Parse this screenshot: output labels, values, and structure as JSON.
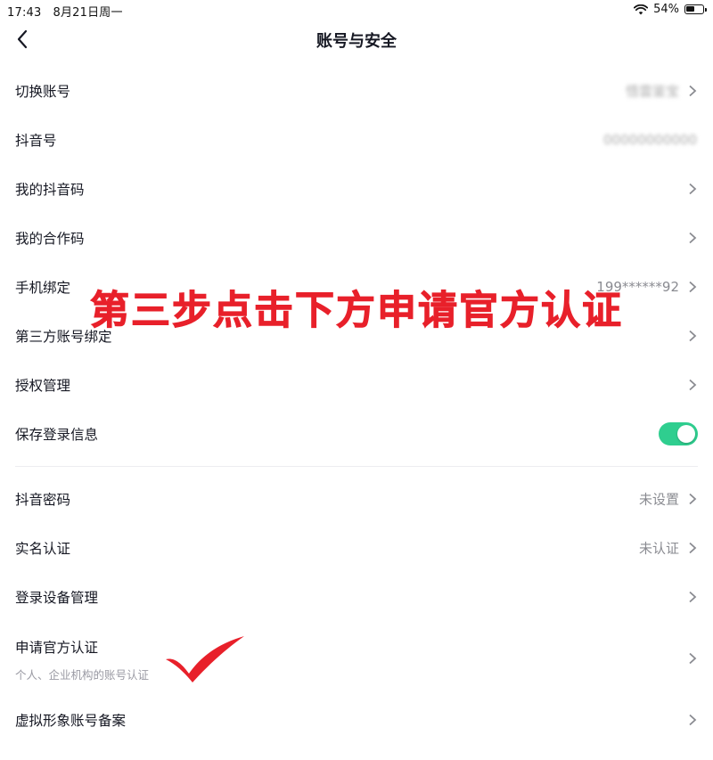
{
  "status_bar": {
    "time": "17:43",
    "date": "8月21日周一",
    "battery": "54%",
    "battery_level": 0.54
  },
  "nav": {
    "title": "账号与安全",
    "back_icon": "chevron-left-icon"
  },
  "rows": [
    {
      "label": "切换账号",
      "value": "悟雲鉴宝",
      "value_blurred": true
    },
    {
      "label": "抖音号",
      "value": "00000000000",
      "value_blurred": true
    },
    {
      "label": "我的抖音码",
      "value": ""
    },
    {
      "label": "我的合作码",
      "value": ""
    },
    {
      "label": "手机绑定",
      "value": "199******92"
    },
    {
      "label": "第三方账号绑定",
      "value": ""
    },
    {
      "label": "授权管理",
      "value": ""
    },
    {
      "label": "保存登录信息",
      "toggle_on": true
    }
  ],
  "rows2": [
    {
      "label": "抖音密码",
      "value": "未设置"
    },
    {
      "label": "实名认证",
      "value": "未认证"
    },
    {
      "label": "登录设备管理",
      "value": ""
    },
    {
      "label": "申请官方认证",
      "sub": "个人、企业机构的账号认证"
    },
    {
      "label": "虚拟形象账号备案",
      "value": ""
    }
  ],
  "overlay": {
    "text": "第三步点击下方申请官方认证"
  },
  "colors": {
    "accent_green": "#2fce8f",
    "overlay_red": "#e8202a",
    "chevron": "#8a8b91"
  }
}
